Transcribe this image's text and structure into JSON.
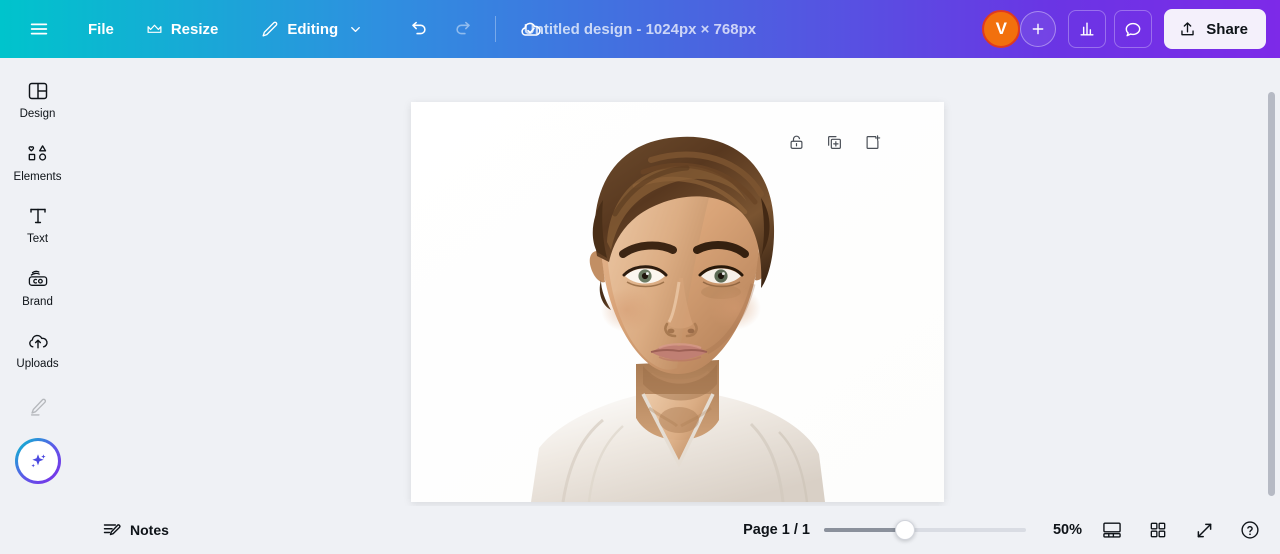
{
  "topbar": {
    "menu_icon": "hamburger-icon",
    "file_label": "File",
    "resize_label": "Resize",
    "resize_icon": "crown-icon",
    "editing_label": "Editing",
    "editing_icon": "pencil-icon",
    "editing_chevron": "chevron-down-icon",
    "undo_icon": "undo-icon",
    "redo_icon": "redo-icon",
    "cloud_icon": "cloud-saved-icon",
    "title": "Untitled design - 1024px × 768px",
    "avatar_initial": "V",
    "add_collaborator_icon": "plus-icon",
    "insights_icon": "bar-chart-icon",
    "comments_icon": "comment-bubble-icon",
    "share_label": "Share",
    "share_icon": "upload-icon",
    "gradient_start": "#00c4cc",
    "gradient_end": "#7d2ae8"
  },
  "sidebar": {
    "items": [
      {
        "label": "Design",
        "icon": "layout-panel-icon"
      },
      {
        "label": "Elements",
        "icon": "shapes-icon"
      },
      {
        "label": "Text",
        "icon": "text-t-icon"
      },
      {
        "label": "Brand",
        "icon": "brand-kit-icon"
      },
      {
        "label": "Uploads",
        "icon": "cloud-upload-icon"
      }
    ],
    "draw_icon": "pen-draw-icon",
    "ai_icon": "magic-sparkles-icon",
    "ai_gradient_start": "#00c4cc",
    "ai_gradient_end": "#7d2ae8"
  },
  "canvas": {
    "tools": [
      {
        "name": "lock-page-button",
        "icon": "lock-icon"
      },
      {
        "name": "duplicate-page-button",
        "icon": "duplicate-icon"
      },
      {
        "name": "add-page-button",
        "icon": "add-page-icon"
      }
    ],
    "background": "#eff1f5",
    "page_background": "#ffffff",
    "image_description": "Portrait photo of a young man with wavy brown hair wearing a white sleeveless top on a white background"
  },
  "bottombar": {
    "notes_label": "Notes",
    "notes_icon": "notes-pencil-icon",
    "page_indicator": "Page 1 / 1",
    "zoom_level": "50%",
    "zoom_slider_percent": 40,
    "page_view_icon": "page-view-icon",
    "grid_view_icon": "grid-view-icon",
    "fullscreen_icon": "expand-arrows-icon",
    "help_icon": "help-question-icon"
  }
}
